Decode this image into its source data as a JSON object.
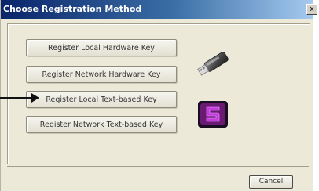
{
  "window": {
    "title": "Choose Registration Method",
    "close_glyph": "x"
  },
  "options": [
    {
      "label": "Register Local Hardware Key"
    },
    {
      "label": "Register Network Hardware Key"
    },
    {
      "label": "Register Local Text-based Key"
    },
    {
      "label": "Register Network Text-based Key"
    }
  ],
  "icons": {
    "hardware": "usb-key-icon",
    "text_based": "text-key-app-icon",
    "pointer": "arrow-pointer-icon"
  },
  "footer": {
    "cancel_label": "Cancel"
  },
  "colors": {
    "titlebar_start": "#0a246a",
    "titlebar_end": "#a6caf0",
    "window_bg": "#ece9d8",
    "app_icon_bg": "#6a1a73",
    "app_icon_glyph": "#c43be0"
  }
}
